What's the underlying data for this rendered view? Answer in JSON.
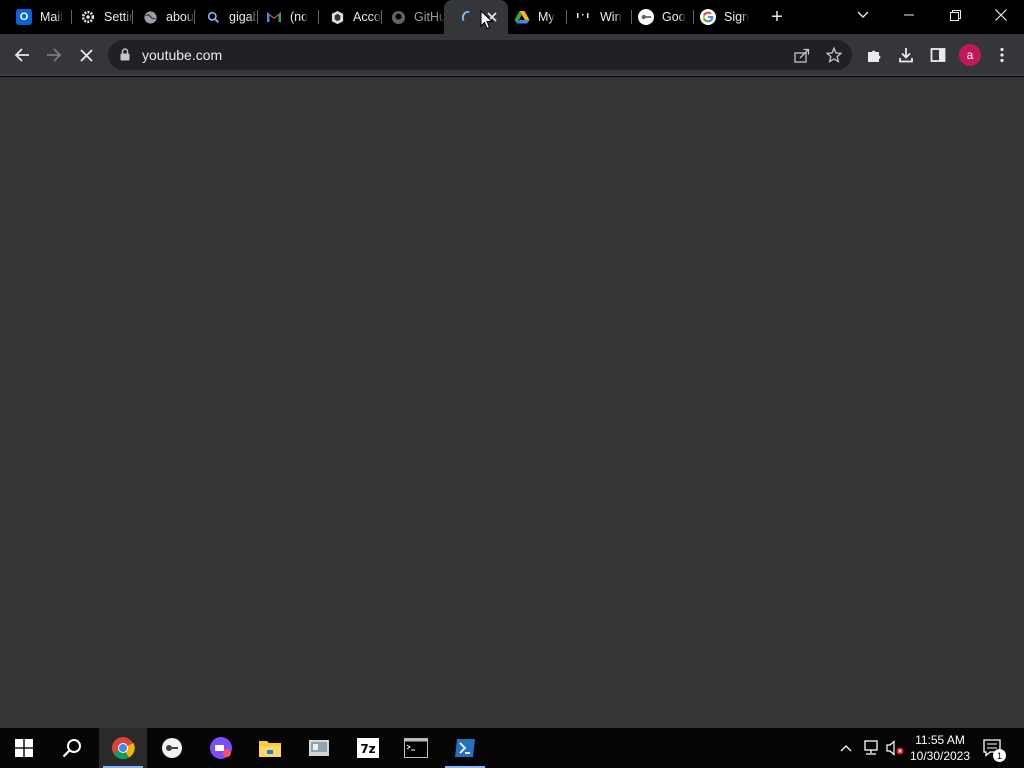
{
  "tabs": [
    {
      "title": "Mail",
      "icon": "outlook-icon"
    },
    {
      "title": "Settings",
      "icon": "gear-icon"
    },
    {
      "title": "about",
      "icon": "globe-icon"
    },
    {
      "title": "gigabyte",
      "icon": "search-icon"
    },
    {
      "title": "(no",
      "icon": "gmail-icon"
    },
    {
      "title": "Accounts",
      "icon": "accounts-icon"
    },
    {
      "title": "GitHub",
      "icon": "github-icon"
    },
    {
      "title": "",
      "icon": "loading-spinner-icon",
      "active": true
    },
    {
      "title": "My",
      "icon": "google-drive-icon"
    },
    {
      "title": "Win",
      "icon": "windows-icon"
    },
    {
      "title": "Goo",
      "icon": "google-meet-icon"
    },
    {
      "title": "Sign",
      "icon": "google-icon"
    }
  ],
  "new_tab_label": "+",
  "toolbar": {
    "url": "youtube.com"
  },
  "profile": {
    "initial": "a",
    "color": "#c2185b"
  },
  "taskbar": {
    "apps": [
      "start",
      "search",
      "chrome",
      "app-2",
      "app-3",
      "file-explorer",
      "app-5",
      "7zip",
      "terminal",
      "powershell"
    ]
  },
  "clock": {
    "time": "11:55 AM",
    "date": "10/30/2023"
  },
  "notifications": {
    "count": "1"
  },
  "colors": {
    "content_bg": "#353535",
    "toolbar_bg": "#35363a",
    "tabstrip_bg": "#000000",
    "accent": "#8ab4f8"
  }
}
